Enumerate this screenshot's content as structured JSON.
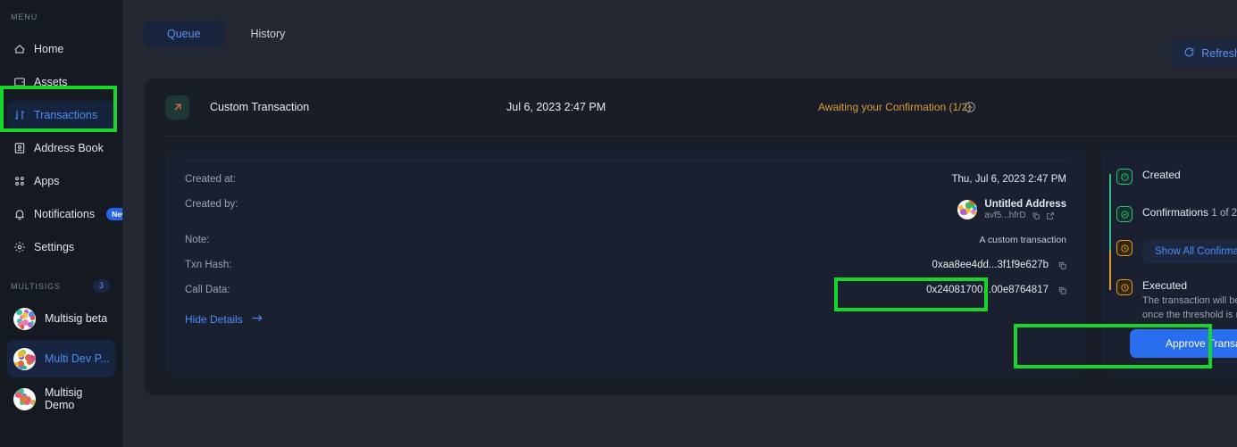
{
  "sidebar": {
    "menu_label": "MENU",
    "items": [
      {
        "label": "Home",
        "icon": "home-icon"
      },
      {
        "label": "Assets",
        "icon": "assets-icon"
      },
      {
        "label": "Transactions",
        "icon": "transactions-icon"
      },
      {
        "label": "Address Book",
        "icon": "address-book-icon"
      },
      {
        "label": "Apps",
        "icon": "apps-icon"
      },
      {
        "label": "Notifications",
        "icon": "bell-icon",
        "badge": "New"
      },
      {
        "label": "Settings",
        "icon": "gear-icon"
      }
    ],
    "multisigs_label": "MULTISIGS",
    "multisigs_count": "3",
    "multisigs": [
      {
        "label": "Multisig beta"
      },
      {
        "label": "Multi Dev P..."
      },
      {
        "label": "Multisig Demo"
      }
    ]
  },
  "toolbar": {
    "tabs": [
      {
        "label": "Queue",
        "active": true
      },
      {
        "label": "History",
        "active": false
      }
    ],
    "refresh_label": "Refresh",
    "refresh_icon": "refresh-icon"
  },
  "transaction": {
    "type_icon": "arrow-up-right-icon",
    "title": "Custom Transaction",
    "date": "Jul 6, 2023 2:47 PM",
    "status": "Awaiting your Confirmation (1/2)",
    "collapse_icon": "chevron-up-circle-icon"
  },
  "details": {
    "created_at_key": "Created at:",
    "created_at_value": "Thu, Jul 6, 2023 2:47 PM",
    "created_by_key": "Created by:",
    "created_by_name": "Untitled Address",
    "created_by_address": "avf5...hfrD",
    "note_key": "Note:",
    "note_value": "A custom transaction",
    "txn_hash_key": "Txn Hash:",
    "txn_hash_value": "0xaa8ee4dd...3f1f9e627b",
    "call_data_key": "Call Data:",
    "call_data_value": "0x24081700...00e8764817",
    "hide_details_label": "Hide Details",
    "copy_icon": "copy-icon",
    "external_link_icon": "external-link-icon",
    "arrow_icon": "arrow-right-icon"
  },
  "timeline": {
    "created_label": "Created",
    "created_icon": "clock-check-icon",
    "confirmations_label": "Confirmations",
    "confirmations_value": "1 of 2",
    "confirmations_icon": "check-circle-icon",
    "pending_icon": "clock-icon",
    "show_all_label": "Show All Confirmations",
    "executed_label": "Executed",
    "executed_icon": "clock-icon",
    "executed_desc": "The transaction will be executed once the threshold is reached.",
    "approve_label": "Approve Transaction"
  },
  "colors": {
    "accent_blue": "#4d8df6",
    "primary_button": "#2a6ef0",
    "status_amber": "#d99b36",
    "timeline_green": "#2fc08a",
    "timeline_amber": "#e0a02e",
    "highlight_green": "#16d62c"
  },
  "highlights": [
    {
      "name": "sidebar-transactions"
    },
    {
      "name": "call-data-value"
    },
    {
      "name": "approve-transaction"
    }
  ]
}
